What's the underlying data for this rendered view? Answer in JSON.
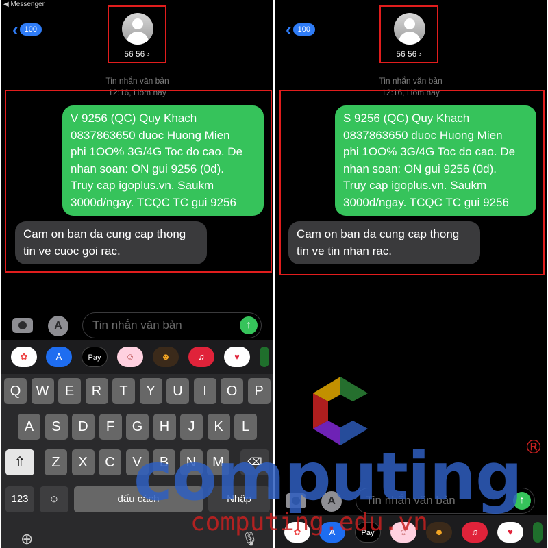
{
  "status_bar": {
    "back_app": "◀ Messenger"
  },
  "nav": {
    "badge_count": "100"
  },
  "contact": {
    "name": "56 56 ›"
  },
  "thread_meta": {
    "label": "Tin nhắn văn bản",
    "time": "12:16, Hôm nay"
  },
  "left": {
    "outgoing": {
      "line1": "V 9256 (QC) Quy Khach",
      "phone": "0837863650",
      "line2_rest": " duoc Huong Mien",
      "line3": "phi 1OO% 3G/4G Toc do cao. De",
      "line4": "nhan soan: ON gui 9256 (0d).",
      "line5_prefix": "Truy cap ",
      "link": "igoplus.vn",
      "line5_suffix": ". Saukm",
      "line6": "3000d/ngay. TCQC TC gui 9256"
    },
    "incoming": {
      "line1": "Cam on ban da cung cap thong",
      "line2": "tin ve cuoc goi rac."
    }
  },
  "right": {
    "outgoing": {
      "line1": "S 9256 (QC) Quy Khach",
      "phone": "0837863650",
      "line2_rest": " duoc Huong Mien",
      "line3": "phi 1OO% 3G/4G Toc do cao. De",
      "line4": "nhan soan: ON gui 9256 (0d).",
      "line5_prefix": "Truy cap ",
      "link": "igoplus.vn",
      "line5_suffix": ". Saukm",
      "line6": "3000d/ngay. TCQC TC gui 9256"
    },
    "incoming": {
      "line1": "Cam on ban da cung cap thong",
      "line2": "tin ve tin nhan rac."
    }
  },
  "composer": {
    "placeholder": "Tin nhắn văn bản",
    "send_icon": "arrow-up-icon"
  },
  "app_drawer": {
    "items": [
      {
        "name": "photos",
        "label": "✿"
      },
      {
        "name": "app-store",
        "label": "A"
      },
      {
        "name": "apple-pay",
        "label": "Pay"
      },
      {
        "name": "memoji",
        "label": "☺"
      },
      {
        "name": "animoji",
        "label": "☻"
      },
      {
        "name": "music",
        "label": "♫"
      },
      {
        "name": "digital-touch",
        "label": "♥"
      }
    ]
  },
  "keyboard": {
    "row1": [
      "Q",
      "W",
      "E",
      "R",
      "T",
      "Y",
      "U",
      "I",
      "O",
      "P"
    ],
    "row2": [
      "A",
      "S",
      "D",
      "F",
      "G",
      "H",
      "J",
      "K",
      "L"
    ],
    "row3": [
      "Z",
      "X",
      "C",
      "V",
      "B",
      "N",
      "M"
    ],
    "numbers_label": "123",
    "space_label": "dấu cách",
    "return_label": "Nhập",
    "emoji_label": "☺",
    "globe_label": "⊕",
    "mic_label": "🎙",
    "shift_label": "⇧",
    "delete_label": "⌫"
  },
  "watermark": {
    "big": "computing",
    "small": "computing.edu.vn",
    "registered": "®"
  },
  "colors": {
    "imessage_green": "#36c35b",
    "incoming_gray": "#3a3a3c",
    "link_blue": "#2f7cf6",
    "highlight_red": "#e11d1d"
  }
}
